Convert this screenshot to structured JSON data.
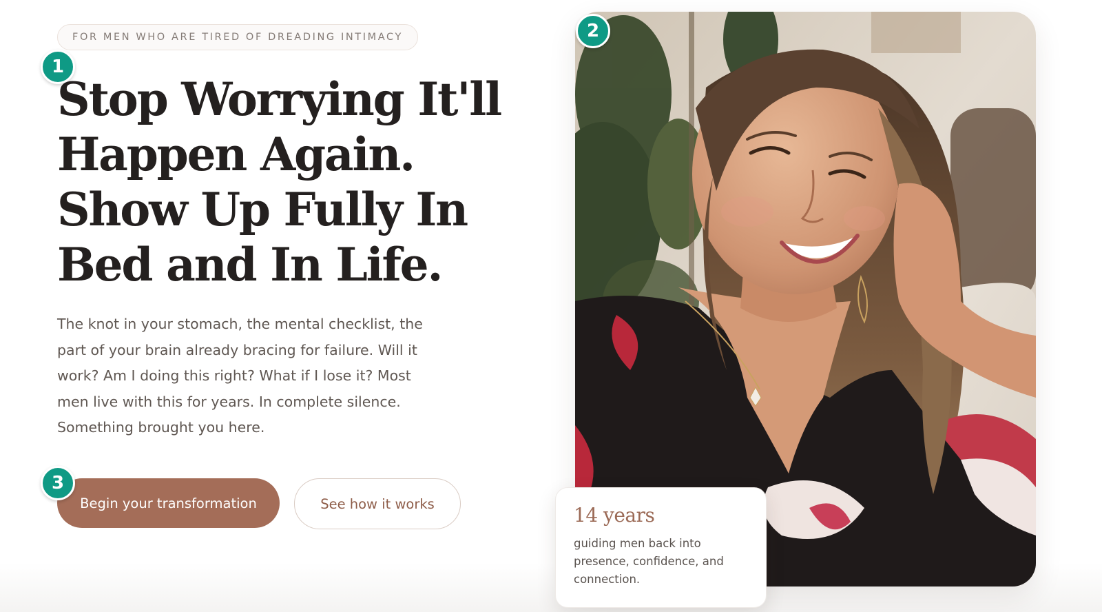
{
  "hero": {
    "eyebrow": "FOR MEN WHO ARE TIRED OF DREADING INTIMACY",
    "headline_lines": [
      "Stop Worrying It'll",
      "Happen Again.",
      "Show Up Fully In",
      "Bed and In Life."
    ],
    "body_lines": [
      "The knot in your stomach, the mental checklist, the",
      "part of your brain already bracing for failure. Will it",
      "work? Am I doing this right? What if I lose it? Most",
      "men live with this for years. In complete silence.",
      "Something brought you here."
    ],
    "primary_cta": "Begin your transformation",
    "secondary_cta": "See how it works"
  },
  "markers": {
    "one": "1",
    "two": "2",
    "three": "3"
  },
  "stat": {
    "number": "14 years",
    "text_lines": [
      "guiding men back into",
      "presence, confidence, and",
      "connection."
    ]
  },
  "photo": {
    "subject": "smiling-woman-portrait"
  },
  "colors": {
    "accent": "#a46d58",
    "marker": "#0f9a85",
    "headline": "#24201f",
    "body": "#5f5752"
  }
}
